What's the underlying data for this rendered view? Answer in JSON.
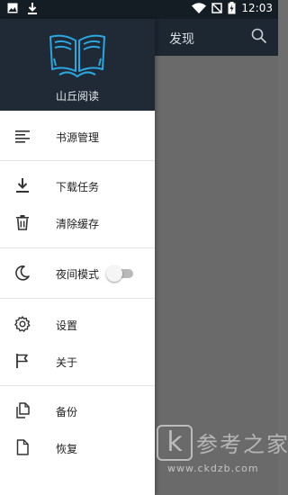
{
  "status_bar": {
    "time": "12:03",
    "left_icons": [
      "image-icon",
      "download-icon"
    ],
    "right_icons": [
      "wifi-icon",
      "no-signal-icon",
      "battery-charging-icon"
    ]
  },
  "app_bar": {
    "title": "发现",
    "search_icon": "search-icon"
  },
  "drawer": {
    "header": {
      "app_name": "山丘阅读",
      "logo_icon": "book-reader-logo",
      "accent_color": "#2aa7e0",
      "background": "#1f2a36"
    },
    "items": [
      {
        "label": "书源管理",
        "icon": "list-icon"
      },
      {
        "label": "下载任务",
        "icon": "download-icon"
      },
      {
        "label": "清除缓存",
        "icon": "trash-icon"
      },
      {
        "label": "夜间模式",
        "icon": "moon-icon",
        "toggle_on": false
      },
      {
        "label": "设置",
        "icon": "gear-icon"
      },
      {
        "label": "关于",
        "icon": "flag-icon"
      },
      {
        "label": "备份",
        "icon": "copy-file-icon"
      },
      {
        "label": "恢复",
        "icon": "file-icon"
      }
    ]
  },
  "watermark": {
    "glyph": "k",
    "name": "参考之家",
    "url": "www.ckdzb.com"
  }
}
